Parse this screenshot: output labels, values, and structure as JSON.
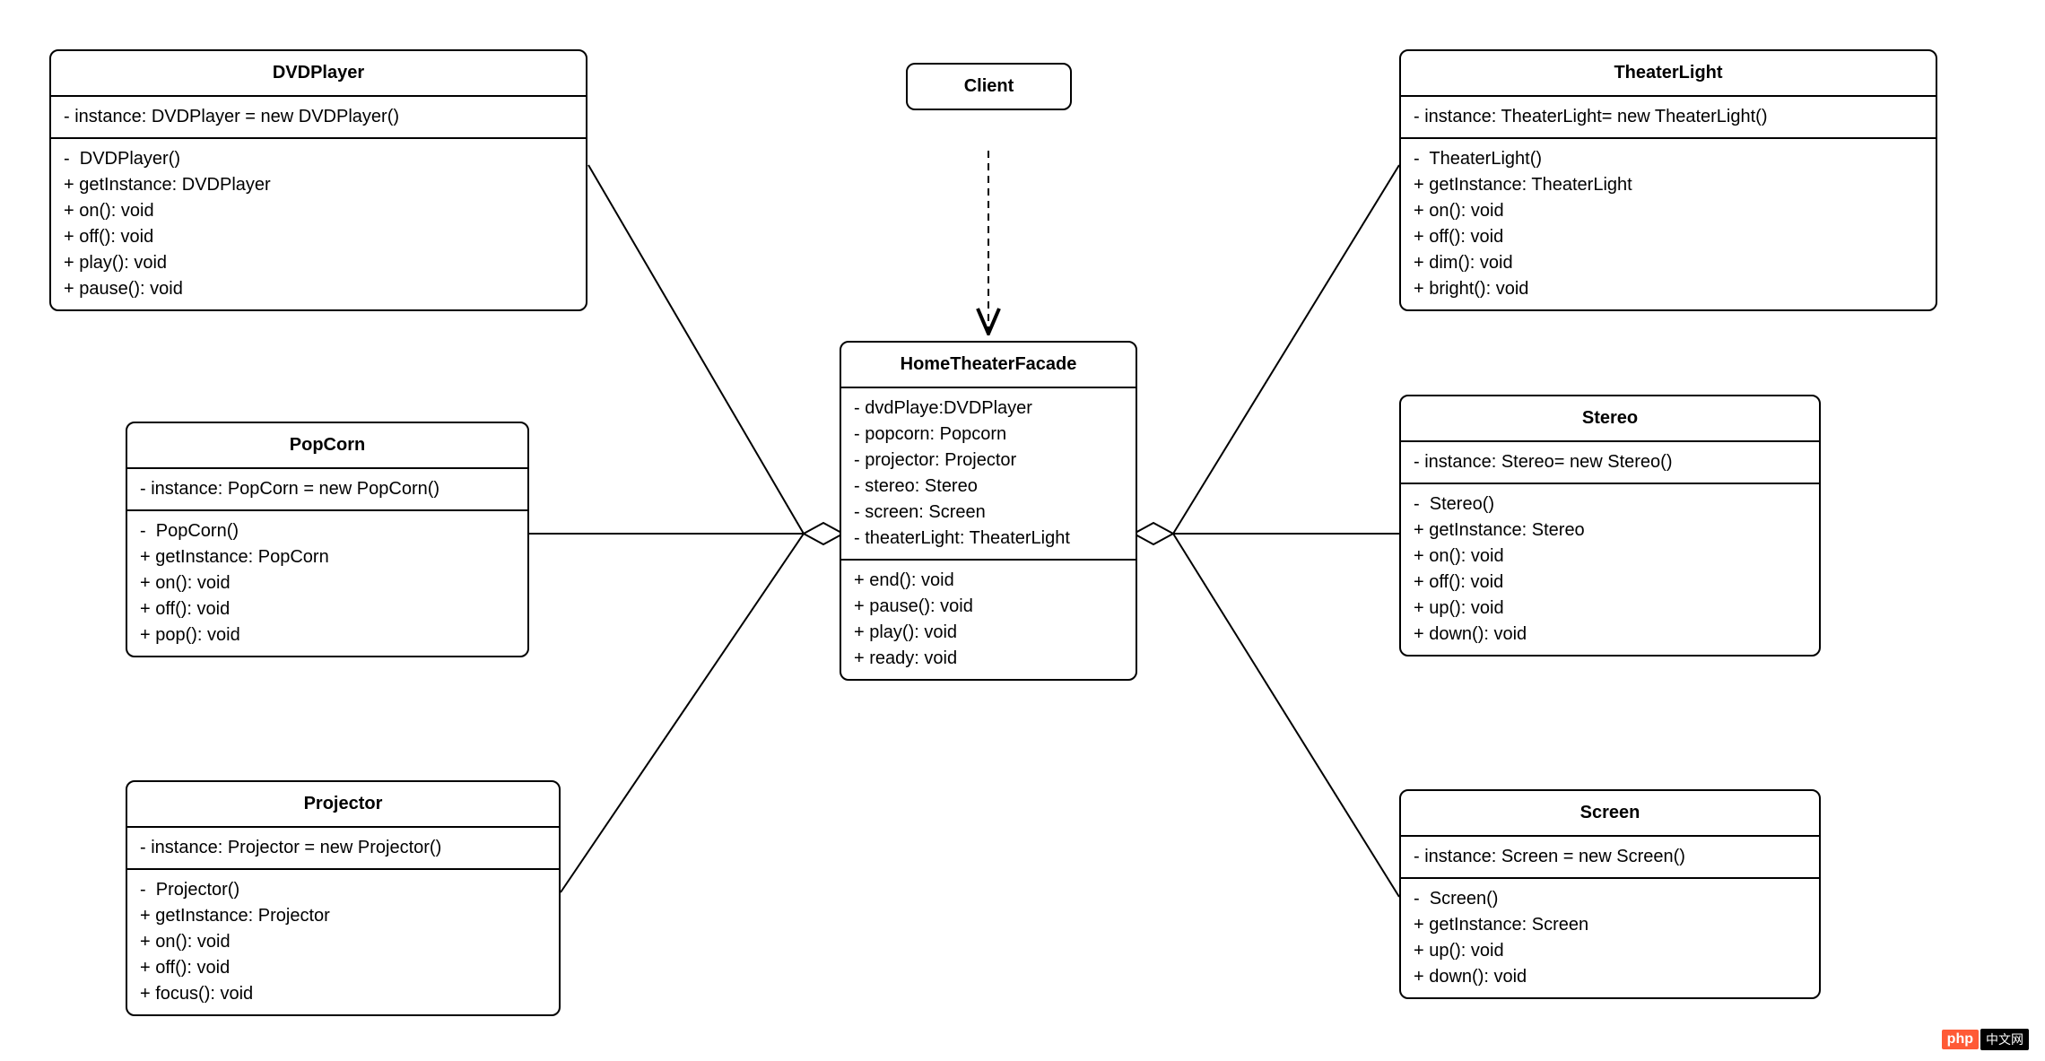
{
  "client": {
    "title": "Client"
  },
  "facade": {
    "title": "HomeTheaterFacade",
    "attrs": "- dvdPlaye:DVDPlayer\n- popcorn: Popcorn\n- projector: Projector\n- stereo: Stereo\n- screen: Screen\n- theaterLight: TheaterLight",
    "ops": "+ end(): void\n+ pause(): void\n+ play(): void\n+ ready: void"
  },
  "dvd": {
    "title": "DVDPlayer",
    "attrs": "- instance: DVDPlayer = new DVDPlayer()",
    "ops": "-  DVDPlayer()\n+ getInstance: DVDPlayer\n+ on(): void\n+ off(): void\n+ play(): void\n+ pause(): void"
  },
  "popcorn": {
    "title": "PopCorn",
    "attrs": "- instance: PopCorn = new PopCorn()",
    "ops": "-  PopCorn()\n+ getInstance: PopCorn\n+ on(): void\n+ off(): void\n+ pop(): void"
  },
  "projector": {
    "title": "Projector",
    "attrs": "- instance: Projector = new Projector()",
    "ops": "-  Projector()\n+ getInstance: Projector\n+ on(): void\n+ off(): void\n+ focus(): void"
  },
  "light": {
    "title": "TheaterLight",
    "attrs": "- instance: TheaterLight= new TheaterLight()",
    "ops": "-  TheaterLight()\n+ getInstance: TheaterLight\n+ on(): void\n+ off(): void\n+ dim(): void\n+ bright(): void"
  },
  "stereo": {
    "title": "Stereo",
    "attrs": "- instance: Stereo= new Stereo()",
    "ops": "-  Stereo()\n+ getInstance: Stereo\n+ on(): void\n+ off(): void\n+ up(): void\n+ down(): void"
  },
  "screen": {
    "title": "Screen",
    "attrs": "- instance: Screen = new Screen()",
    "ops": "-  Screen()\n+ getInstance: Screen\n+ up(): void\n+ down(): void"
  },
  "watermark": {
    "php": "php",
    "cn": "中文网"
  }
}
